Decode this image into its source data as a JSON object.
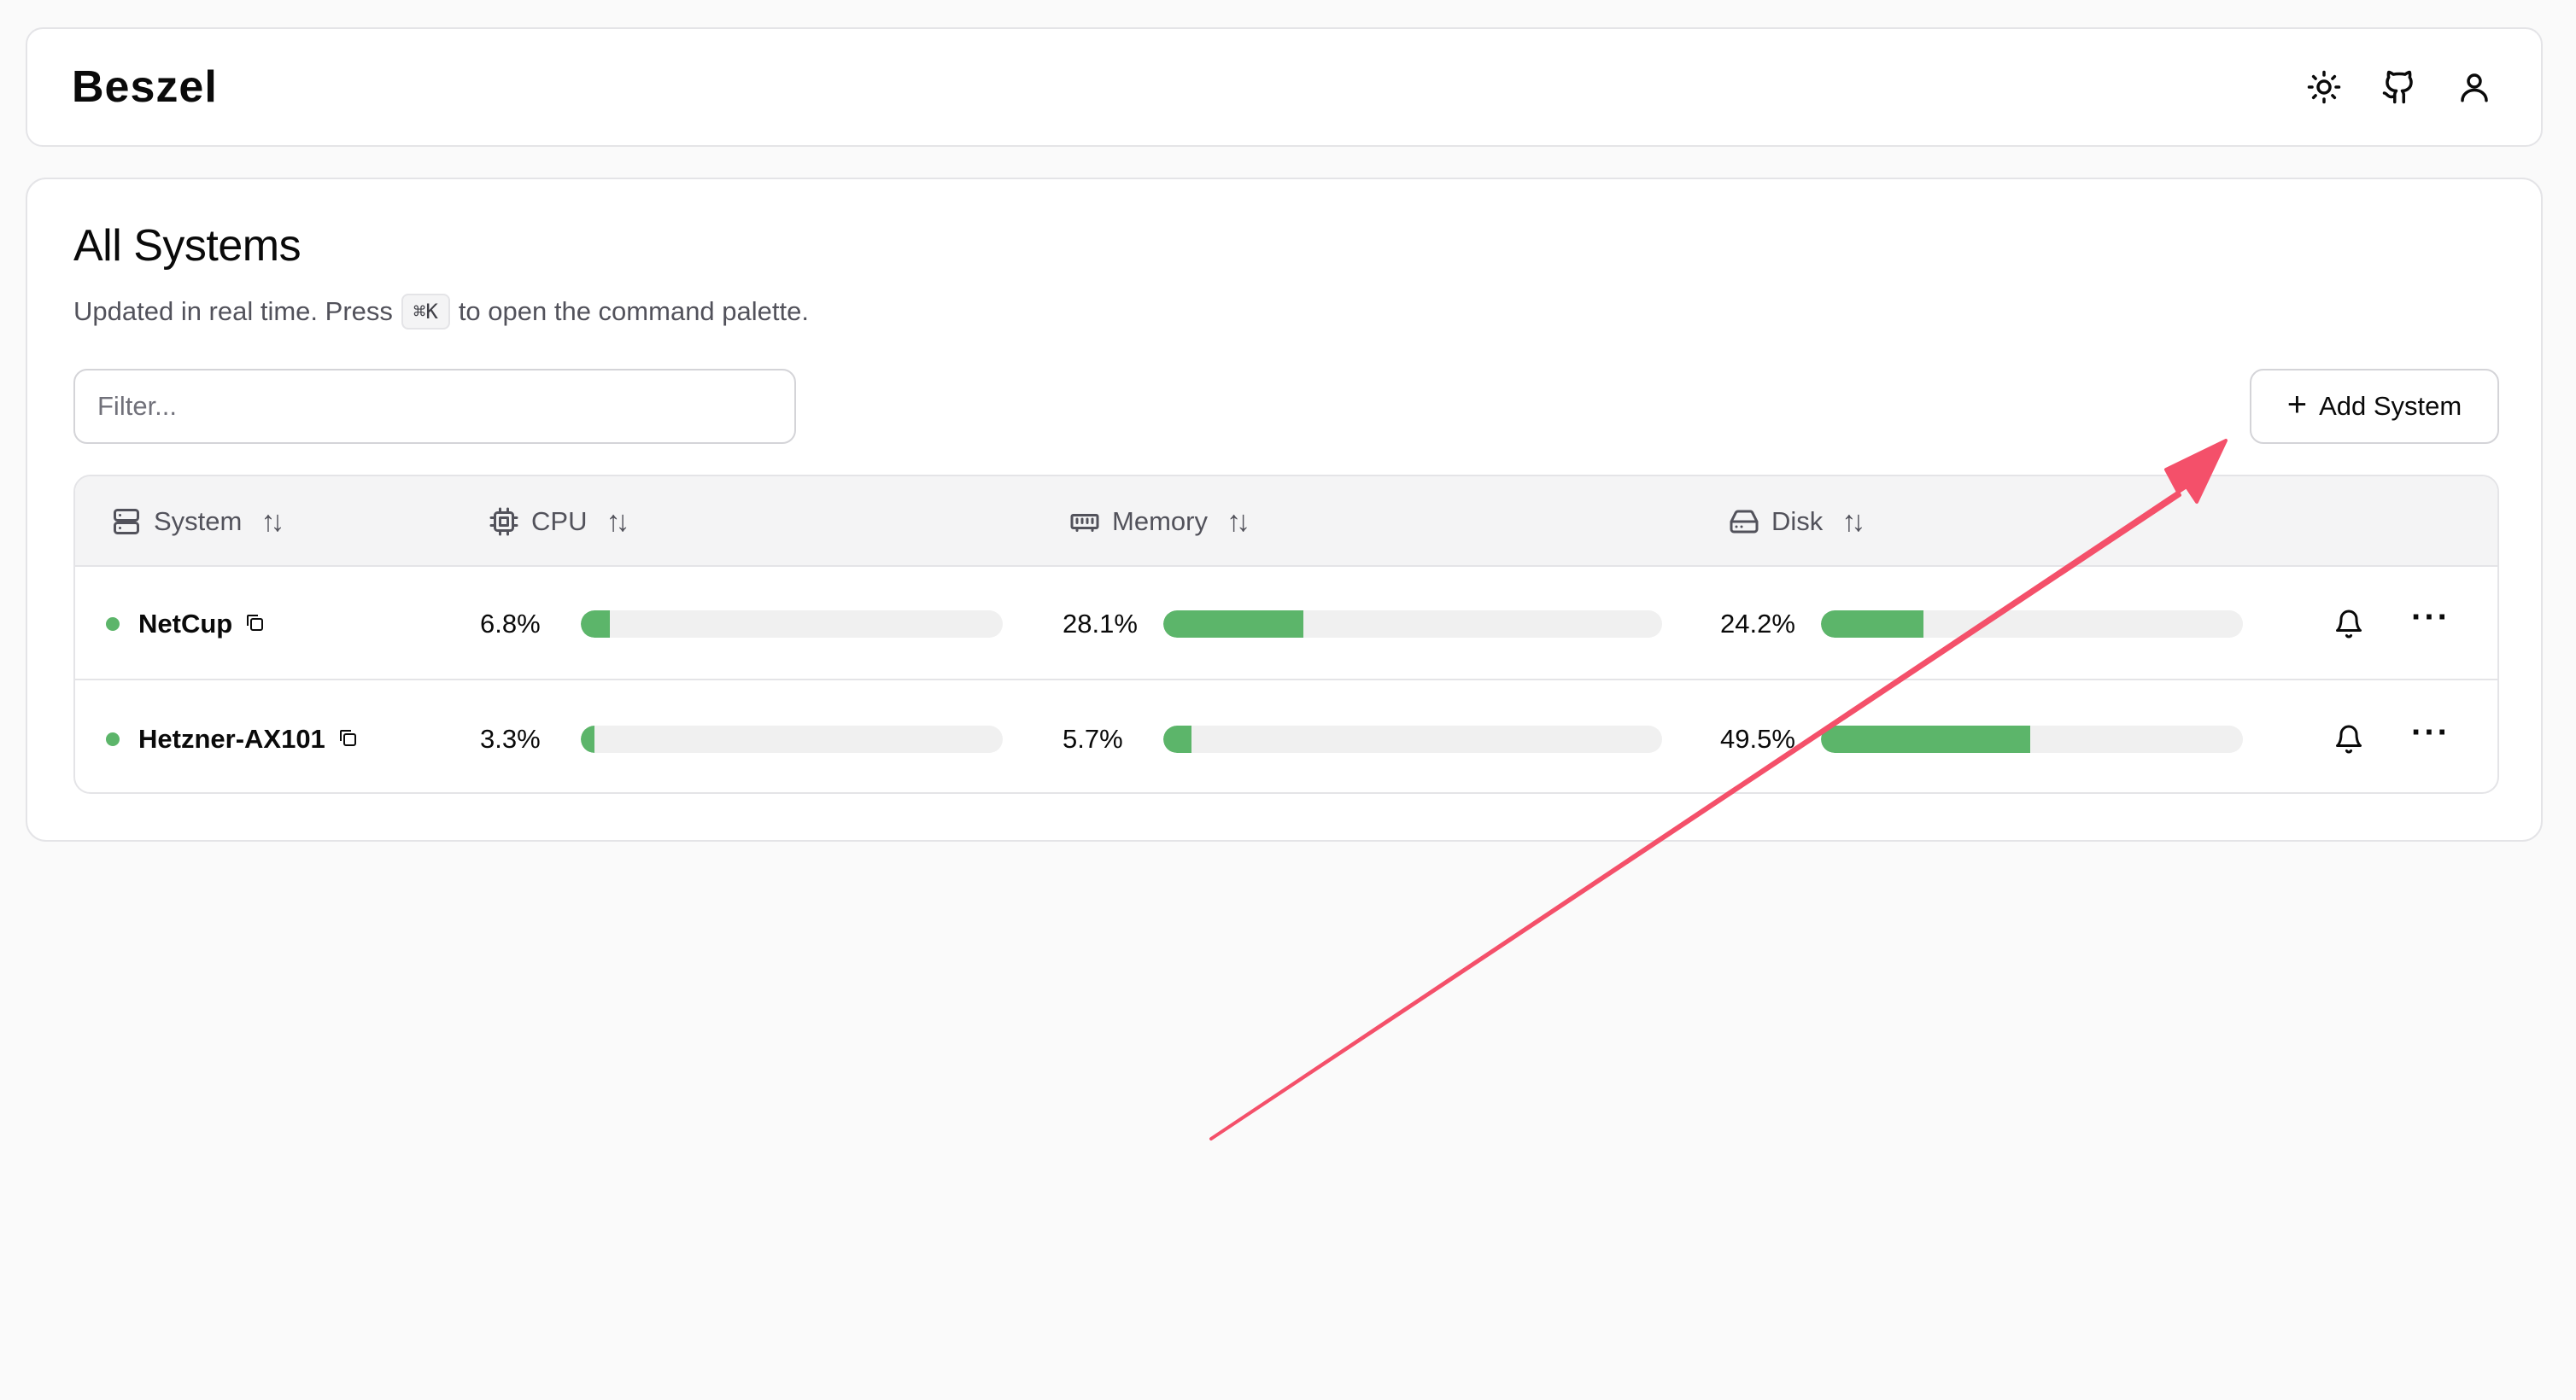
{
  "header": {
    "brand": "Beszel",
    "icons": [
      "sun-icon",
      "github-icon",
      "user-icon"
    ]
  },
  "main": {
    "title": "All Systems",
    "subtitle_before": "Updated in real time. Press",
    "shortcut": "⌘K",
    "subtitle_after": "to open the command palette.",
    "filter_placeholder": "Filter...",
    "add_button": "Add System"
  },
  "table": {
    "columns": [
      {
        "label": "System",
        "icon": "server-icon"
      },
      {
        "label": "CPU",
        "icon": "cpu-icon"
      },
      {
        "label": "Memory",
        "icon": "memory-icon"
      },
      {
        "label": "Disk",
        "icon": "disk-icon"
      }
    ],
    "rows": [
      {
        "name": "NetCup",
        "status": "up",
        "cpu": "6.8%",
        "cpu_pct": 6.8,
        "memory": "28.1%",
        "memory_pct": 28.1,
        "disk": "24.2%",
        "disk_pct": 24.2
      },
      {
        "name": "Hetzner-AX101",
        "status": "up",
        "cpu": "3.3%",
        "cpu_pct": 3.3,
        "memory": "5.7%",
        "memory_pct": 5.7,
        "disk": "49.5%",
        "disk_pct": 49.5
      }
    ]
  },
  "colors": {
    "accent_green": "#5cb56a",
    "annotation_arrow": "#f4506a"
  }
}
